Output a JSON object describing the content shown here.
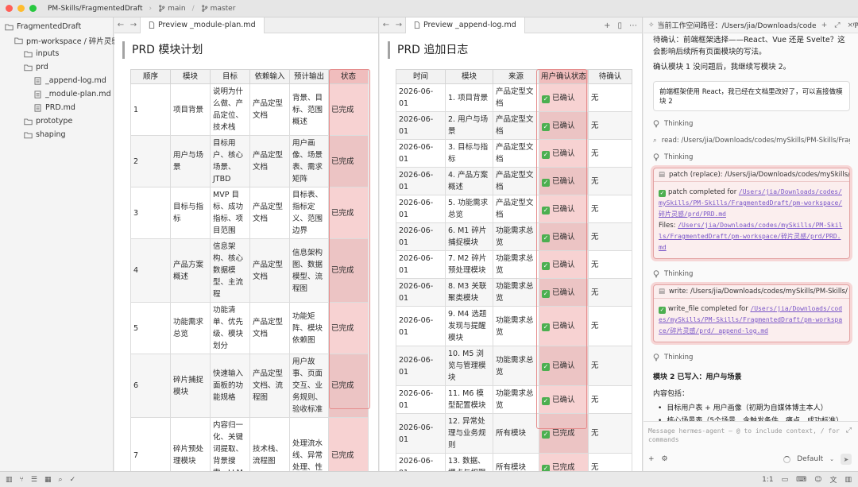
{
  "titlebar": {
    "project": "PM-Skills/FragmentedDraft",
    "branch1": "main",
    "branch2": "master"
  },
  "sidebar": {
    "items": [
      {
        "label": "FragmentedDraft",
        "type": "folder",
        "indent": 0
      },
      {
        "label": "pm-workspace / 碎片灵感",
        "type": "folder",
        "indent": 1
      },
      {
        "label": "inputs",
        "type": "folder",
        "indent": 2
      },
      {
        "label": "prd",
        "type": "folder",
        "indent": 2
      },
      {
        "label": "_append-log.md",
        "type": "file",
        "indent": 3
      },
      {
        "label": "_module-plan.md",
        "type": "file",
        "indent": 3
      },
      {
        "label": "PRD.md",
        "type": "file",
        "indent": 3
      },
      {
        "label": "prototype",
        "type": "folder",
        "indent": 2
      },
      {
        "label": "shaping",
        "type": "folder",
        "indent": 2
      }
    ]
  },
  "pane1": {
    "tab": "Preview _module-plan.md",
    "title": "PRD 模块计划",
    "headers": [
      "顺序",
      "模块",
      "目标",
      "依赖输入",
      "预计输出",
      "状态"
    ],
    "rows": [
      [
        "1",
        "项目背景",
        "说明为什么做、产品定位、技术栈",
        "产品定型文档",
        "背景、目标、范围概述",
        "已完成"
      ],
      [
        "2",
        "用户与场景",
        "目标用户、核心场景、JTBD",
        "产品定型文档",
        "用户画像、场景表、需求矩阵",
        "已完成"
      ],
      [
        "3",
        "目标与指标",
        "MVP 目标、成功指标、项目范围",
        "产品定型文档",
        "目标表、指标定义、范围边界",
        "已完成"
      ],
      [
        "4",
        "产品方案概述",
        "信息架构、核心数据模型、主流程",
        "产品定型文档",
        "信息架构图、数据模型、流程图",
        "已完成"
      ],
      [
        "5",
        "功能需求总览",
        "功能清单、优先级、模块划分",
        "产品定型文档",
        "功能矩阵、模块依赖图",
        "已完成"
      ],
      [
        "6",
        "碎片捕捉模块",
        "快速输入面板的功能规格",
        "产品定型文档、流程图",
        "用户故事、页面交互、业务规则、验收标准",
        "已完成"
      ],
      [
        "7",
        "碎片预处理模块",
        "内容归一化、关键词提取、背景搜索、LLM整",
        "技术栈、流程图",
        "处理流水线、异常处理、性",
        "已完成"
      ]
    ]
  },
  "pane2": {
    "tab": "Preview _append-log.md",
    "title": "PRD 追加日志",
    "headers": [
      "时间",
      "模块",
      "来源",
      "用户确认状态",
      "待确认"
    ],
    "rows": [
      [
        "2026-06-01",
        "1. 项目背景",
        "产品定型文档",
        "已确认",
        "无"
      ],
      [
        "2026-06-01",
        "2. 用户与场景",
        "产品定型文档",
        "已确认",
        "无"
      ],
      [
        "2026-06-01",
        "3. 目标与指标",
        "产品定型文档",
        "已确认",
        "无"
      ],
      [
        "2026-06-01",
        "4. 产品方案概述",
        "产品定型文档",
        "已确认",
        "无"
      ],
      [
        "2026-06-01",
        "5. 功能需求总览",
        "产品定型文档",
        "已确认",
        "无"
      ],
      [
        "2026-06-01",
        "6. M1 碎片捕捉模块",
        "功能需求总览",
        "已确认",
        "无"
      ],
      [
        "2026-06-01",
        "7. M2 碎片预处理模块",
        "功能需求总览",
        "已确认",
        "无"
      ],
      [
        "2026-06-01",
        "8. M3 关联聚类模块",
        "功能需求总览",
        "已确认",
        "无"
      ],
      [
        "2026-06-01",
        "9. M4 选题发现与提醒模块",
        "功能需求总览",
        "已确认",
        "无"
      ],
      [
        "2026-06-01",
        "10. M5 浏览与管理模块",
        "功能需求总览",
        "已确认",
        "无"
      ],
      [
        "2026-06-01",
        "11. M6 模型配置模块",
        "功能需求总览",
        "已确认",
        "无"
      ],
      [
        "2026-06-01",
        "12. 异常处理与业务规则",
        "所有模块",
        "已完成",
        "无"
      ],
      [
        "2026-06-01",
        "13. 数据、埋点与权限",
        "所有模块",
        "已完成",
        "无"
      ]
    ]
  },
  "chat": {
    "header": "当前工作空间路径：/Users/jia/Downloads/codes/mySkills/PM-Skills",
    "ai_intro_1": "待确认：前端框架选择——React、Vue 还是 Svelte？这会影响后续所有页面模块的写法。",
    "ai_intro_2": "确认模块 1 没问题后，我继续写模块 2。",
    "user_msg": "前端框架使用 React，我已经在文档里改好了，可以直接做模块 2",
    "thinking": "Thinking",
    "read_line": "read: /Users/jia/Downloads/codes/mySkills/PM-Skills/FragmentedDraft",
    "patch": {
      "header": "patch (replace): /Users/jia/Downloads/codes/mySkills/PM-Skills",
      "completed": "patch completed for",
      "path": "/Users/jia/Downloads/codes/mySkills/PM-Skills/FragmentedDraft/pm-workspace/碎片灵感/prd/PRD.md",
      "files_label": "Files:",
      "files_path": "/Users/jia/Downloads/codes/mySkills/PM-Skills/FragmentedDraft/pm-workspace/碎片灵感/prd/PRD.md"
    },
    "write": {
      "header": "write: /Users/jia/Downloads/codes/mySkills/PM-Skills/",
      "completed": "write_file completed for",
      "path": "/Users/jia/Downloads/codes/mySkills/PM-Skills/FragmentedDraft/pm-workspace/碎片灵感/prd/_append-log.md"
    },
    "summary_title": "模块 2 已写入：用户与场景",
    "summary_sub": "内容包括：",
    "bullets": [
      "目标用户表 + 用户画像（初期为自媒体博主本人）",
      "核心场景表（5个场景，含触发条件、痛点、成功标准）",
      "JTBD 分析（核心 Job + 功能性任务 F1-F5 + 情感性任务"
    ],
    "composer_placeholder": "Message hermes-agent — @ to include context, / for commands",
    "model": "Default"
  },
  "statusbar": {
    "zoom": "1:1"
  }
}
